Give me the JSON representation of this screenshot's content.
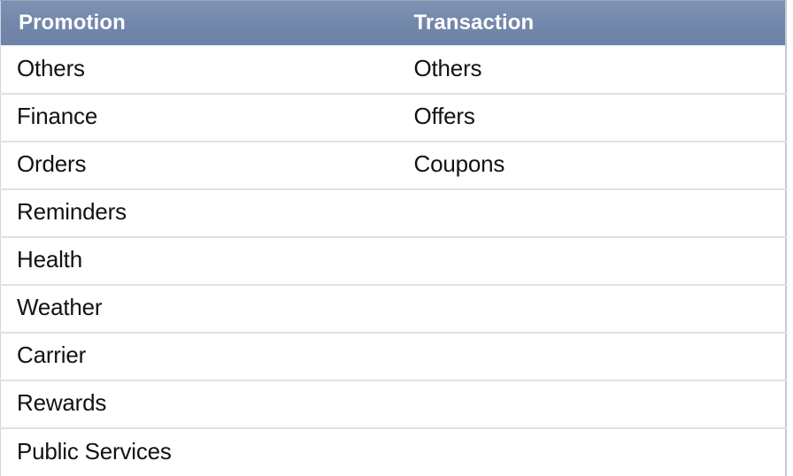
{
  "table": {
    "columns": [
      {
        "key": "promotion",
        "header": "Promotion"
      },
      {
        "key": "transaction",
        "header": "Transaction"
      }
    ],
    "header_bg_color": "#7288ab",
    "header_text_color": "#ffffff",
    "row_separator_color": "#dfe1e9",
    "border_color": "#c3c9d8",
    "rows": [
      {
        "promotion": "Others",
        "transaction": "Others"
      },
      {
        "promotion": "Finance",
        "transaction": "Offers"
      },
      {
        "promotion": "Orders",
        "transaction": "Coupons"
      },
      {
        "promotion": "Reminders",
        "transaction": ""
      },
      {
        "promotion": "Health",
        "transaction": ""
      },
      {
        "promotion": "Weather",
        "transaction": ""
      },
      {
        "promotion": "Carrier",
        "transaction": ""
      },
      {
        "promotion": "Rewards",
        "transaction": ""
      },
      {
        "promotion": "Public Services",
        "transaction": ""
      }
    ]
  }
}
